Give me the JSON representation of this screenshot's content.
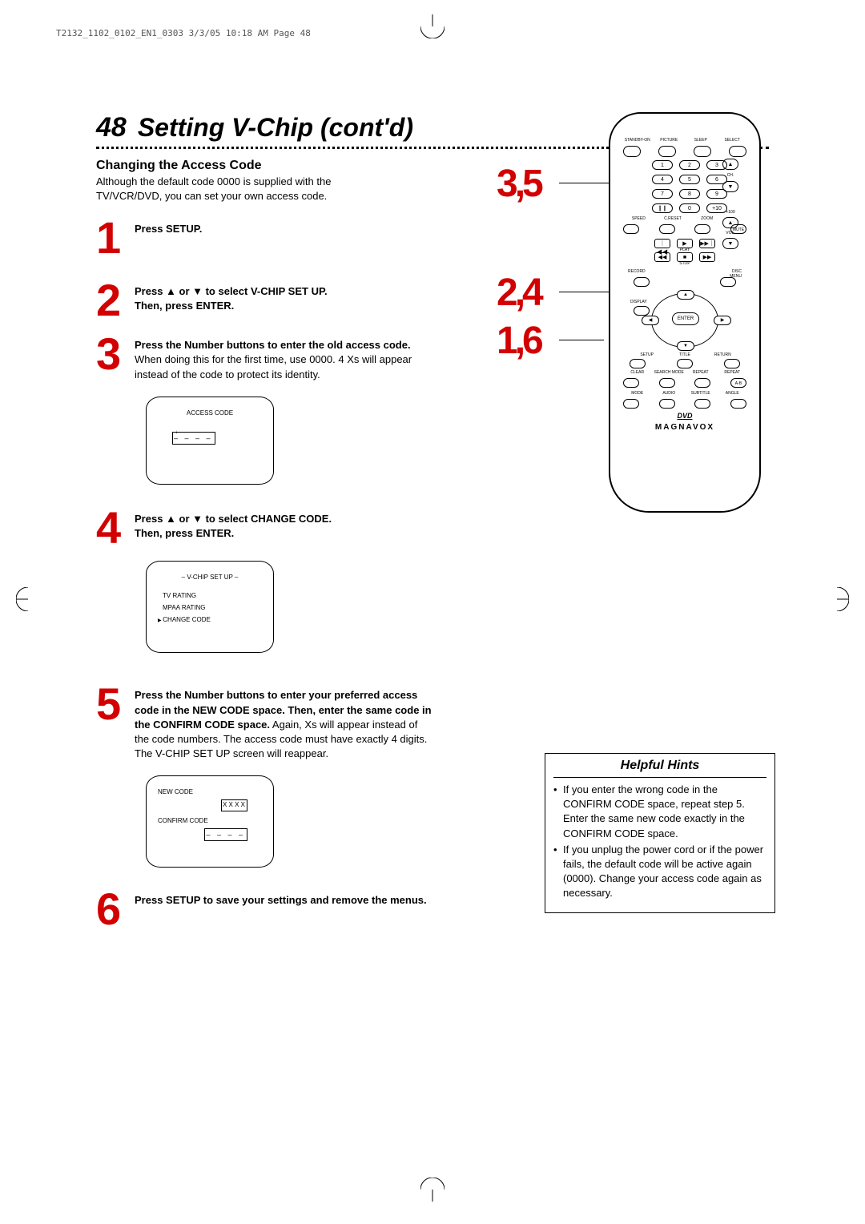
{
  "header_strip": "T2132_1102_0102_EN1_0303  3/3/05  10:18 AM  Page 48",
  "page_number": "48",
  "chapter_title": "Setting V-Chip (cont'd)",
  "subheading": "Changing the Access Code",
  "intro": "Although the default code 0000 is supplied with the TV/VCR/DVD, you can set your own access code.",
  "steps": {
    "s1": {
      "num": "1",
      "text_bold": "Press SETUP."
    },
    "s2": {
      "num": "2",
      "line1": "Press ▲ or ▼ to select V-CHIP SET UP.",
      "line2": "Then, press ENTER."
    },
    "s3": {
      "num": "3",
      "bold": "Press the Number buttons to enter the old access code.",
      "rest": " When doing this for the first time, use 0000. 4 Xs will appear instead of the code to protect its identity."
    },
    "s4": {
      "num": "4",
      "line1": "Press ▲ or ▼ to select CHANGE CODE.",
      "line2": "Then, press ENTER."
    },
    "s5": {
      "num": "5",
      "bold": "Press the Number buttons to enter your preferred access code in the NEW CODE space. Then, enter the same code in the CONFIRM CODE space.",
      "rest": " Again, Xs will appear instead of the code numbers. The access code must have exactly 4 digits.",
      "tail": "The V-CHIP SET UP screen will reappear."
    },
    "s6": {
      "num": "6",
      "bold": "Press SETUP to save your settings and remove the menus."
    }
  },
  "screen1": {
    "title": "ACCESS CODE",
    "value": "– – – –"
  },
  "screen2": {
    "title": "– V-CHIP SET UP –",
    "line1": "TV RATING",
    "line2": "MPAA RATING",
    "line3": "CHANGE CODE"
  },
  "screen3": {
    "line1": "NEW CODE",
    "val1": "X X X X",
    "line2": "CONFIRM CODE",
    "val2": "– – – –"
  },
  "callouts": {
    "c35": "3,5",
    "c24": "2,4",
    "c16": "1,6"
  },
  "remote": {
    "top_labels": [
      "STANDBY-ON",
      "PICTURE",
      "SLEEP",
      "SELECT"
    ],
    "nums": [
      "1",
      "2",
      "3",
      "4",
      "5",
      "6",
      "7",
      "8",
      "9",
      "",
      "0",
      "+10"
    ],
    "plus100": "+100",
    "pause_sym": "❙❙",
    "ch": "CH.",
    "vol": "VOL.",
    "row3_labels": [
      "SPEED",
      "C.RESET",
      "ZOOM"
    ],
    "mute": "MUTE",
    "play": "PLAY",
    "stop": "STOP",
    "record": "RECORD",
    "disc_menu_a": "DISC",
    "disc_menu_b": "MENU",
    "display": "DISPLAY",
    "enter": "ENTER",
    "setup": "SETUP",
    "title": "TITLE",
    "return": "RETURN",
    "bottom1": [
      "CLEAR",
      "SEARCH MODE",
      "REPEAT",
      "REPEAT"
    ],
    "ab": "A-B",
    "bottom2": [
      "MODE",
      "AUDIO",
      "SUBTITLE",
      "ANGLE"
    ],
    "dvd": "DVD",
    "brand": "MAGNAVOX"
  },
  "hints": {
    "title": "Helpful Hints",
    "item1": "If you enter the wrong code in the CONFIRM CODE space, repeat step 5. Enter the same new code exactly in the CONFIRM CODE space.",
    "item2": "If you unplug the power cord or if the power fails, the default code will be active again (0000). Change your access code again as necessary."
  }
}
